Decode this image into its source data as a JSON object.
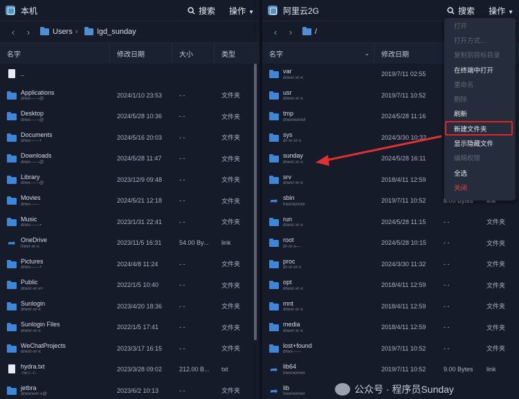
{
  "left": {
    "title": "本机",
    "search": "搜索",
    "ops": "操作",
    "breadcrumb": [
      "Users",
      "lgd_sunday"
    ],
    "headers": [
      "名字",
      "修改日期",
      "大小",
      "类型"
    ],
    "rows": [
      {
        "icon": "file",
        "name": "..",
        "perm": "",
        "date": "",
        "size": "",
        "type": ""
      },
      {
        "icon": "folder",
        "name": "Applications",
        "perm": "drwx------@",
        "date": "2024/1/10 23:53",
        "size": "- -",
        "type": "文件夹"
      },
      {
        "icon": "folder",
        "name": "Desktop",
        "perm": "drwx------@",
        "date": "2024/5/28 10:36",
        "size": "- -",
        "type": "文件夹"
      },
      {
        "icon": "folder",
        "name": "Documents",
        "perm": "drwx------+",
        "date": "2024/5/16 20:03",
        "size": "- -",
        "type": "文件夹"
      },
      {
        "icon": "folder",
        "name": "Downloads",
        "perm": "drwx------@",
        "date": "2024/5/28 11:47",
        "size": "- -",
        "type": "文件夹"
      },
      {
        "icon": "folder",
        "name": "Library",
        "perm": "drwx------@",
        "date": "2023/12/9 09:48",
        "size": "- -",
        "type": "文件夹"
      },
      {
        "icon": "folder",
        "name": "Movies",
        "perm": "drwx------",
        "date": "2024/5/21 12:18",
        "size": "- -",
        "type": "文件夹"
      },
      {
        "icon": "folder",
        "name": "Music",
        "perm": "drwx------+",
        "date": "2023/1/31 22:41",
        "size": "- -",
        "type": "文件夹"
      },
      {
        "icon": "link",
        "name": "OneDrive",
        "perm": "lrwxr-xr-x",
        "date": "2023/11/5 16:31",
        "size": "54.00 By...",
        "type": "link"
      },
      {
        "icon": "folder",
        "name": "Pictures",
        "perm": "drwx------+",
        "date": "2024/4/8 11:24",
        "size": "- -",
        "type": "文件夹"
      },
      {
        "icon": "folder",
        "name": "Public",
        "perm": "drwxr-xr-x+",
        "date": "2022/1/5 10:40",
        "size": "- -",
        "type": "文件夹"
      },
      {
        "icon": "folder",
        "name": "Sunlogin",
        "perm": "drwxr-xr-x",
        "date": "2023/4/20 18:36",
        "size": "- -",
        "type": "文件夹"
      },
      {
        "icon": "folder",
        "name": "Sunlogin Files",
        "perm": "drwxr-xr-x",
        "date": "2022/1/5 17:41",
        "size": "- -",
        "type": "文件夹"
      },
      {
        "icon": "folder",
        "name": "WeChatProjects",
        "perm": "drwxr-xr-x",
        "date": "2023/3/17 16:15",
        "size": "- -",
        "type": "文件夹"
      },
      {
        "icon": "file",
        "name": "hydra.txt",
        "perm": "-rw-r--r--",
        "date": "2023/3/28 09:02",
        "size": "212.00 B...",
        "type": "txt"
      },
      {
        "icon": "folder",
        "name": "jetbra",
        "perm": "drwxrwxr-x@",
        "date": "2023/6/2 10:13",
        "size": "- -",
        "type": "文件夹"
      }
    ]
  },
  "right": {
    "title": "阿里云2G",
    "search": "搜索",
    "ops": "操作",
    "breadcrumb": [
      "/"
    ],
    "headers": [
      "名字",
      "修改日期"
    ],
    "rows": [
      {
        "icon": "folder",
        "name": "var",
        "perm": "drwxr-xr-x",
        "date": "2019/7/11 02:55",
        "size": "",
        "type": ""
      },
      {
        "icon": "folder",
        "name": "usr",
        "perm": "drwxr-xr-x",
        "date": "2019/7/11 10:52",
        "size": "",
        "type": ""
      },
      {
        "icon": "folder",
        "name": "tmp",
        "perm": "drwxrwxrwt",
        "date": "2024/5/28 11:16",
        "size": "",
        "type": ""
      },
      {
        "icon": "folder",
        "name": "sys",
        "perm": "dr-xr-xr-x",
        "date": "2024/3/30 10:32",
        "size": "",
        "type": ""
      },
      {
        "icon": "folder",
        "name": "sunday",
        "perm": "drwxr-xr-x",
        "date": "2024/5/28 16:11",
        "size": "",
        "type": ""
      },
      {
        "icon": "folder",
        "name": "srv",
        "perm": "drwxr-xr-x",
        "date": "2018/4/11 12:59",
        "size": "",
        "type": ""
      },
      {
        "icon": "link",
        "name": "sbin",
        "perm": "lrwxrwxrwx",
        "date": "2019/7/11 10:52",
        "size": "8.00 Bytes",
        "type": "link"
      },
      {
        "icon": "folder",
        "name": "run",
        "perm": "drwxr-xr-x",
        "date": "2024/5/28 11:15",
        "size": "- -",
        "type": "文件夹"
      },
      {
        "icon": "folder",
        "name": "root",
        "perm": "dr-xr-x---",
        "date": "2024/5/28 10:15",
        "size": "- -",
        "type": "文件夹"
      },
      {
        "icon": "folder",
        "name": "proc",
        "perm": "dr-xr-xr-x",
        "date": "2024/3/30 11:32",
        "size": "- -",
        "type": "文件夹"
      },
      {
        "icon": "folder",
        "name": "opt",
        "perm": "drwxr-xr-x",
        "date": "2018/4/11 12:59",
        "size": "- -",
        "type": "文件夹"
      },
      {
        "icon": "folder",
        "name": "mnt",
        "perm": "drwxr-xr-x",
        "date": "2018/4/11 12:59",
        "size": "- -",
        "type": "文件夹"
      },
      {
        "icon": "folder",
        "name": "media",
        "perm": "drwxr-xr-x",
        "date": "2018/4/11 12:59",
        "size": "- -",
        "type": "文件夹"
      },
      {
        "icon": "folder",
        "name": "lost+found",
        "perm": "drwx------",
        "date": "2019/7/11 10:52",
        "size": "- -",
        "type": "文件夹"
      },
      {
        "icon": "link",
        "name": "lib64",
        "perm": "lrwxrwxrwx",
        "date": "2019/7/11 10:52",
        "size": "9.00 Bytes",
        "type": "link"
      },
      {
        "icon": "link",
        "name": "lib",
        "perm": "lrwxrwxrwx",
        "date": "",
        "size": "",
        "type": ""
      }
    ]
  },
  "menu": [
    {
      "label": "打开",
      "state": "dis"
    },
    {
      "label": "打开方式...",
      "state": "dis"
    },
    {
      "label": "复制到目标目录",
      "state": "dis"
    },
    {
      "label": "在终端中打开",
      "state": "en"
    },
    {
      "label": "重命名",
      "state": "dis"
    },
    {
      "label": "删除",
      "state": "dis"
    },
    {
      "label": "刷新",
      "state": "en"
    },
    {
      "label": "新建文件夹",
      "state": "hl"
    },
    {
      "label": "显示隐藏文件",
      "state": "en"
    },
    {
      "label": "编辑权限",
      "state": "dis"
    },
    {
      "label": "全选",
      "state": "en"
    },
    {
      "label": "关闭",
      "state": "red"
    }
  ],
  "watermark": "公众号 · 程序员Sunday",
  "colors": {
    "accent": "#3d86d8",
    "highlight": "#e02323",
    "arrow": "#e03030"
  }
}
